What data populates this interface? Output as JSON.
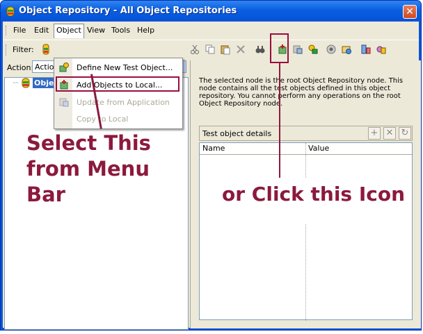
{
  "window": {
    "title": "Object Repository - All Object Repositories",
    "close_label": "✕"
  },
  "menubar": {
    "items": [
      {
        "label": "File"
      },
      {
        "label": "Edit"
      },
      {
        "label": "Object"
      },
      {
        "label": "View"
      },
      {
        "label": "Tools"
      },
      {
        "label": "Help"
      }
    ]
  },
  "toolbar": {
    "filter_label": "Filter:"
  },
  "action": {
    "label": "Action:",
    "selected": "Actio"
  },
  "tree": {
    "root_label": "Obje"
  },
  "object_menu": {
    "items": [
      {
        "label": "Define New Test Object...",
        "enabled": true
      },
      {
        "label": "Add Objects to Local...",
        "enabled": true
      },
      {
        "label": "Update from Application",
        "enabled": false
      },
      {
        "label": "Copy to Local",
        "enabled": false
      }
    ]
  },
  "details": {
    "description": "The selected node is the root Object Repository node. This node contains all the test objects defined in this object repository. You cannot perform any operations on the root Object Repository node.",
    "panel_title": "Test object details",
    "add_label": "+",
    "remove_label": "✕",
    "refresh_label": "↻",
    "columns": [
      "Name",
      "Value"
    ]
  },
  "annotations": {
    "left": "Select This from Menu Bar",
    "right": "or Click this Icon"
  },
  "colors": {
    "annotation": "#8b1a3d",
    "titlebar": "#0a5fe0",
    "face": "#ece9d8"
  }
}
